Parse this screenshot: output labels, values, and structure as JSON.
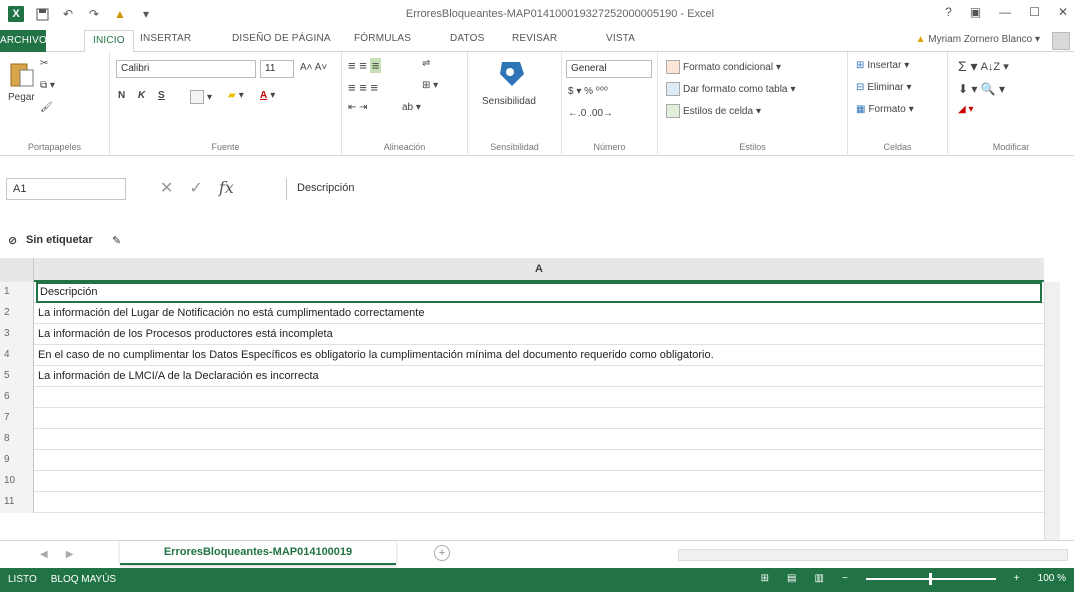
{
  "window": {
    "title": "ErroresBloqueantes-MAP014100019327252000005190 - Excel",
    "controls": [
      "?",
      "▣",
      "—",
      "☐",
      "✕"
    ]
  },
  "qat": {
    "logo": "X"
  },
  "tabs": [
    {
      "label": "ARCHIVO"
    },
    {
      "label": "INICIO"
    },
    {
      "label": "INSERTAR"
    },
    {
      "label": "DISEÑO DE PÁGINA"
    },
    {
      "label": "FÓRMULAS"
    },
    {
      "label": "DATOS"
    },
    {
      "label": "REVISAR"
    },
    {
      "label": "VISTA"
    }
  ],
  "user": {
    "name": "Myriam Zornero Blanco"
  },
  "ribbon": {
    "clipboard": {
      "paste": "Pegar",
      "label": "Portapapeles"
    },
    "font": {
      "name": "Calibri",
      "size": "11",
      "bold": "N",
      "italic": "K",
      "underline": "S",
      "label": "Fuente"
    },
    "alignment": {
      "label": "Alineación"
    },
    "sensitivity": {
      "button": "Sensibilidad",
      "label": "Sensibilidad"
    },
    "number": {
      "format": "General",
      "label": "Número"
    },
    "styles": {
      "conditional": "Formato condicional",
      "table": "Dar formato como tabla",
      "cell": "Estilos de celda",
      "label": "Estilos"
    },
    "cells": {
      "insert": "Insertar",
      "delete": "Eliminar",
      "format": "Formato",
      "label": "Celdas"
    },
    "editing": {
      "label": "Modificar"
    }
  },
  "formula_bar": {
    "name_box": "A1",
    "fx": "fx",
    "content": "Descripción"
  },
  "label_bar": {
    "text": "Sin etiquetar"
  },
  "grid": {
    "column": "A",
    "rows": [
      {
        "num": "1",
        "value": "Descripción"
      },
      {
        "num": "2",
        "value": "La información del Lugar de Notificación no está cumplimentado correctamente"
      },
      {
        "num": "3",
        "value": "La información de los Procesos productores está incompleta"
      },
      {
        "num": "4",
        "value": "En el caso de no cumplimentar los Datos Específicos es obligatorio la cumplimentación mínima del documento requerido como obligatorio."
      },
      {
        "num": "5",
        "value": "La información de LMCI/A de la Declaración es incorrecta"
      },
      {
        "num": "6",
        "value": ""
      },
      {
        "num": "7",
        "value": ""
      },
      {
        "num": "8",
        "value": ""
      },
      {
        "num": "9",
        "value": ""
      },
      {
        "num": "10",
        "value": ""
      },
      {
        "num": "11",
        "value": ""
      }
    ]
  },
  "sheets": {
    "active": "ErroresBloqueantes-MAP014100019",
    "add": "+"
  },
  "status": {
    "left": [
      "LISTO",
      "BLOQ MAYÚS"
    ],
    "zoom": "100 %"
  },
  "colors": {
    "accent": "#217346"
  }
}
